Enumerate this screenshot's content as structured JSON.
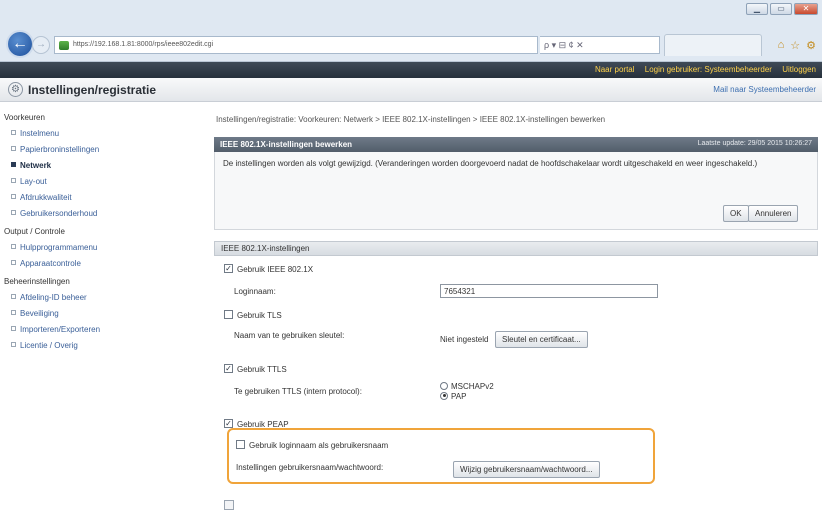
{
  "browser": {
    "url": "https://192.168.1.81:8000/rps/ieee802edit.cgi",
    "search_hint": "ρ ▾ ⊟ ¢ ✕",
    "window_buttons": [
      "▁",
      "▭",
      "✕"
    ],
    "right_icons": [
      "⌂",
      "☆",
      "⚙"
    ]
  },
  "topbar": {
    "portal_link": "Naar portal",
    "login_label": "Login gebruiker: Systeembeheerder",
    "logout_link": "Uitloggen"
  },
  "titlebar": {
    "title": "Instellingen/registratie",
    "mail_link": "Mail naar Systeembeheerder"
  },
  "sidebar": {
    "sections": [
      {
        "heading": "Voorkeuren",
        "items": [
          {
            "label": "Instelmenu",
            "active": false
          },
          {
            "label": "Papierbroninstellingen",
            "active": false
          },
          {
            "label": "Netwerk",
            "active": true
          },
          {
            "label": "Lay-out",
            "active": false
          },
          {
            "label": "Afdrukkwaliteit",
            "active": false
          },
          {
            "label": "Gebruikersonderhoud",
            "active": false
          }
        ]
      },
      {
        "heading": "Output / Controle",
        "items": [
          {
            "label": "Hulpprogrammamenu",
            "active": false
          },
          {
            "label": "Apparaatcontrole",
            "active": false
          }
        ]
      },
      {
        "heading": "Beheerinstellingen",
        "items": [
          {
            "label": "Afdeling-ID beheer",
            "active": false
          },
          {
            "label": "Beveiliging",
            "active": false
          },
          {
            "label": "Importeren/Exporteren",
            "active": false
          },
          {
            "label": "Licentie / Overig",
            "active": false
          }
        ]
      }
    ]
  },
  "main": {
    "breadcrumb": "Instellingen/registratie: Voorkeuren: Netwerk > IEEE 802.1X-instellingen > IEEE 802.1X-instellingen bewerken",
    "panel_title": "IEEE 802.1X-instellingen bewerken",
    "last_update": "Laatste update: 29/05 2015 10:26:27",
    "description": "De instellingen worden als volgt gewijzigd. (Veranderingen worden doorgevoerd nadat de hoofdschakelaar wordt uitgeschakeld en weer ingeschakeld.)",
    "ok_button": "OK",
    "cancel_button": "Annuleren",
    "settings_title": "IEEE 802.1X-instellingen",
    "use_ieee": {
      "label": "Gebruik IEEE 802.1X",
      "checked": true
    },
    "login_name_label": "Loginnaam:",
    "login_name_value": "7654321",
    "use_tls": {
      "label": "Gebruik TLS",
      "checked": false
    },
    "key_name_label": "Naam van te gebruiken sleutel:",
    "key_name_value": "Niet ingesteld",
    "key_cert_button": "Sleutel en certificaat...",
    "use_ttls": {
      "label": "Gebruik TTLS",
      "checked": true
    },
    "ttls_protocol_label": "Te gebruiken TTLS (intern protocol):",
    "ttls_options": [
      {
        "label": "MSCHAPv2",
        "selected": false
      },
      {
        "label": "PAP",
        "selected": true
      }
    ],
    "use_peap": {
      "label": "Gebruik PEAP",
      "checked": true
    },
    "use_login_as_user": {
      "label": "Gebruik loginnaam als gebruikersnaam",
      "checked": false
    },
    "user_pw_label": "Instellingen gebruikersnaam/wachtwoord:",
    "user_pw_button": "Wijzig gebruikersnaam/wachtwoord..."
  }
}
